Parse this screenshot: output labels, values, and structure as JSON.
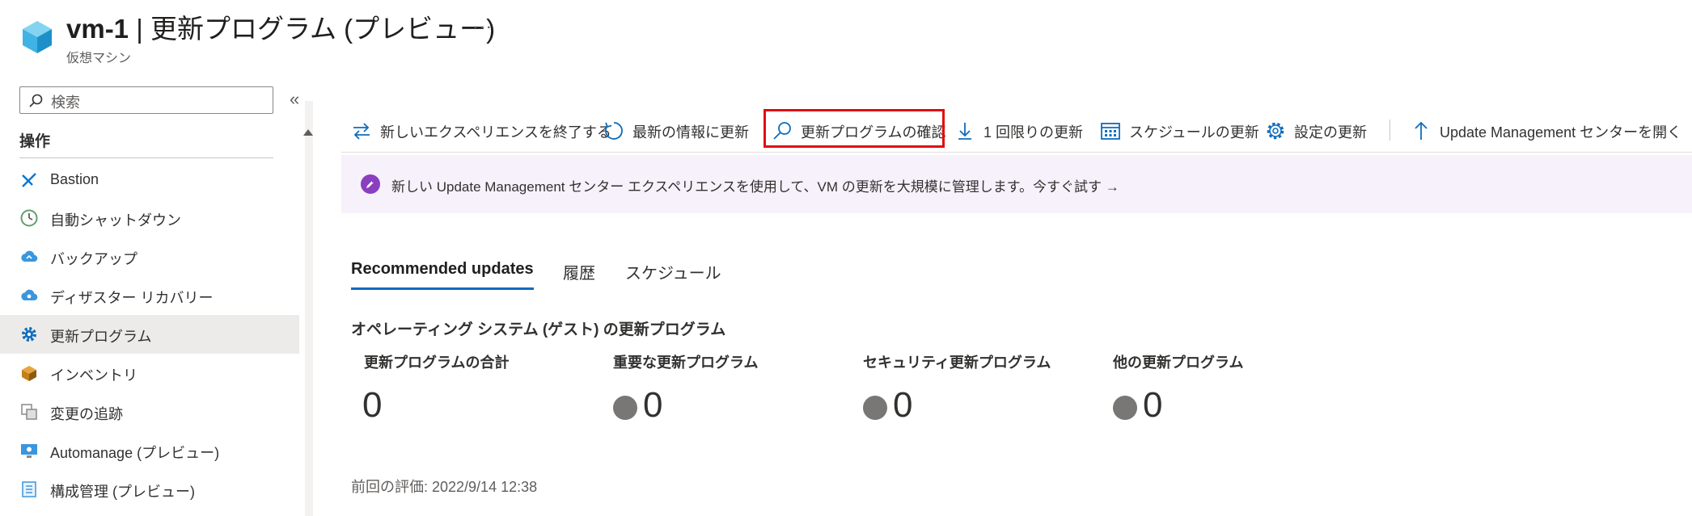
{
  "header": {
    "title_vm": "vm-1",
    "title_rest": " | 更新プログラム (プレビュー)",
    "subtitle": "仮想マシン",
    "more": "···"
  },
  "sidebar": {
    "search_placeholder": "検索",
    "collapse": "«",
    "section": "操作",
    "items": [
      {
        "label": "Bastion",
        "icon": "bastion-icon"
      },
      {
        "label": "自動シャットダウン",
        "icon": "clock-icon"
      },
      {
        "label": "バックアップ",
        "icon": "cloud-backup-icon"
      },
      {
        "label": "ディザスター リカバリー",
        "icon": "cloud-recovery-icon"
      },
      {
        "label": "更新プログラム",
        "icon": "gear-icon",
        "active": true
      },
      {
        "label": "インベントリ",
        "icon": "inventory-icon"
      },
      {
        "label": "変更の追跡",
        "icon": "change-tracking-icon"
      },
      {
        "label": "Automanage (プレビュー)",
        "icon": "monitor-icon"
      },
      {
        "label": "構成管理 (プレビュー)",
        "icon": "config-icon"
      }
    ]
  },
  "toolbar": {
    "exit_experience": "新しいエクスペリエンスを終了する",
    "refresh": "最新の情報に更新",
    "check_updates": "更新プログラムの確認",
    "one_time_update": "1 回限りの更新",
    "schedule_update": "スケジュールの更新",
    "settings_update": "設定の更新",
    "open_center": "Update Management センターを開く"
  },
  "banner": {
    "text": "新しい Update Management センター エクスペリエンスを使用して、VM の更新を大規模に管理します。今すぐ試す →"
  },
  "tabs": [
    "Recommended updates",
    "履歴",
    "スケジュール"
  ],
  "content": {
    "heading": "オペレーティング システム (ゲスト) の更新プログラム",
    "stats": [
      {
        "label": "更新プログラムの合計",
        "value": "0"
      },
      {
        "label": "重要な更新プログラム",
        "value": "0"
      },
      {
        "label": "セキュリティ更新プログラム",
        "value": "0"
      },
      {
        "label": "他の更新プログラム",
        "value": "0"
      }
    ],
    "last_assessment": "前回の評価: 2022/9/14 12:38"
  },
  "colors": {
    "accent": "#0f6cbd",
    "highlight": "#e00e0e",
    "banner_bg": "#f7f1fb",
    "rocket": "#8a3fbf",
    "dot": "#797775"
  }
}
